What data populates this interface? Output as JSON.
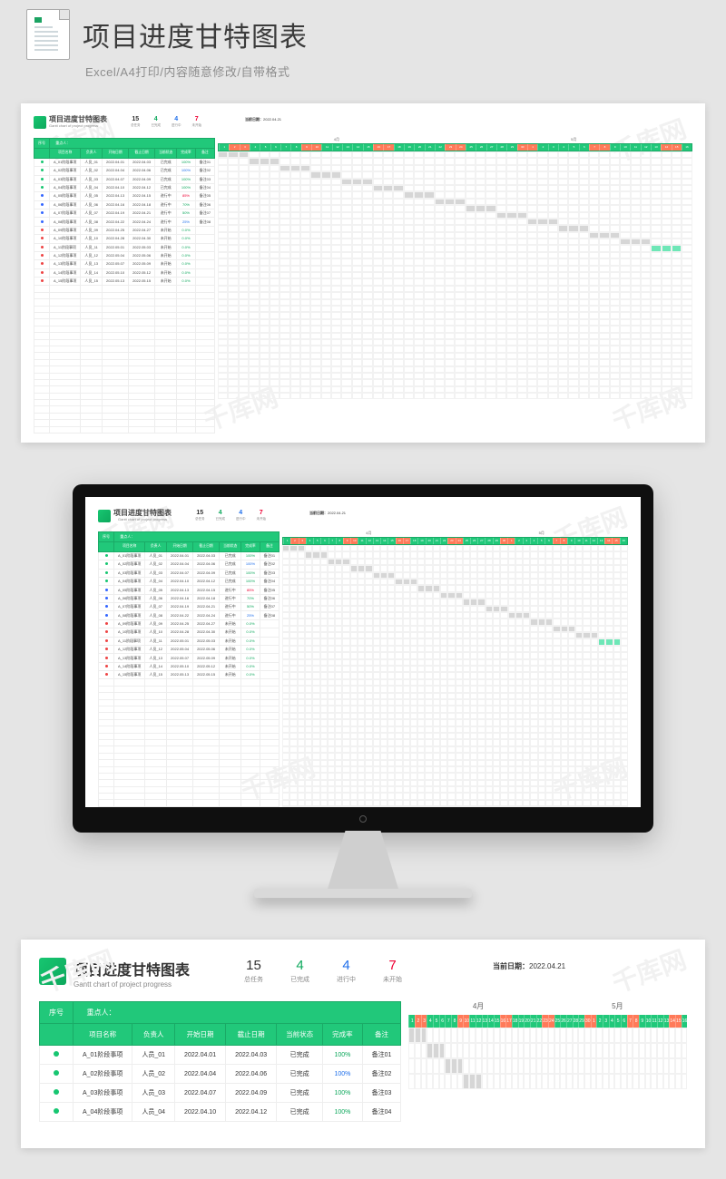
{
  "header": {
    "title": "项目进度甘特图表",
    "subtitle": "Excel/A4打印/内容随意修改/自带格式"
  },
  "watermark": "千库网",
  "template": {
    "title": "项目进度甘特图表",
    "title_en": "Gantt chart of project progress",
    "stats": [
      {
        "n": "15",
        "l": "总任务",
        "color": "#333"
      },
      {
        "n": "4",
        "l": "已完成",
        "color": "#0da85c"
      },
      {
        "n": "4",
        "l": "进行中",
        "color": "#1f6feb"
      },
      {
        "n": "7",
        "l": "未开始",
        "color": "#e03"
      }
    ],
    "date_label": "当前日期：",
    "date_value": "2022.04.21",
    "cols_top": [
      "序号",
      "",
      "",
      "",
      "",
      "",
      "",
      ""
    ],
    "cols": [
      "",
      "项目名称",
      "负责人",
      "开始日期",
      "截止日期",
      "当前状态",
      "完成率",
      "备注"
    ],
    "rows": [
      {
        "c": "g",
        "name": "A_01阶段事项",
        "owner": "人员_01",
        "start": "2022.04.01",
        "end": "2022.04.03",
        "status": "已完成",
        "pct": "100%",
        "pcls": "pct-green",
        "note": "备注01"
      },
      {
        "c": "g",
        "name": "A_02阶段事项",
        "owner": "人员_02",
        "start": "2022.04.04",
        "end": "2022.04.06",
        "status": "已完成",
        "pct": "100%",
        "pcls": "pct-blue",
        "note": "备注02"
      },
      {
        "c": "g",
        "name": "A_03阶段事项",
        "owner": "人员_03",
        "start": "2022.04.07",
        "end": "2022.04.09",
        "status": "已完成",
        "pct": "100%",
        "pcls": "pct-green",
        "note": "备注03"
      },
      {
        "c": "g",
        "name": "A_04阶段事项",
        "owner": "人员_04",
        "start": "2022.04.10",
        "end": "2022.04.12",
        "status": "已完成",
        "pct": "100%",
        "pcls": "pct-green",
        "note": "备注04"
      },
      {
        "c": "b",
        "name": "A_05阶段事项",
        "owner": "人员_05",
        "start": "2022.04.13",
        "end": "2022.04.15",
        "status": "进行中",
        "pct": "85%",
        "pcls": "pct-red",
        "note": "备注05"
      },
      {
        "c": "b",
        "name": "A_06阶段事项",
        "owner": "人员_06",
        "start": "2022.04.16",
        "end": "2022.04.18",
        "status": "进行中",
        "pct": "70%",
        "pcls": "pct-green",
        "note": "备注06"
      },
      {
        "c": "b",
        "name": "A_07阶段事项",
        "owner": "人员_07",
        "start": "2022.04.19",
        "end": "2022.04.21",
        "status": "进行中",
        "pct": "50%",
        "pcls": "pct-green",
        "note": "备注07"
      },
      {
        "c": "b",
        "name": "A_08阶段事项",
        "owner": "人员_08",
        "start": "2022.04.22",
        "end": "2022.04.24",
        "status": "进行中",
        "pct": "25%",
        "pcls": "pct-blue",
        "note": "备注08"
      },
      {
        "c": "r",
        "name": "A_09阶段事项",
        "owner": "人员_09",
        "start": "2022.04.25",
        "end": "2022.04.27",
        "status": "未开始",
        "pct": "0.0%",
        "pcls": "pct-green",
        "note": ""
      },
      {
        "c": "r",
        "name": "A_10阶段事项",
        "owner": "人员_10",
        "start": "2022.04.28",
        "end": "2022.04.30",
        "status": "未开始",
        "pct": "0.0%",
        "pcls": "pct-green",
        "note": ""
      },
      {
        "c": "r",
        "name": "A_11阶段事项",
        "owner": "人员_11",
        "start": "2022.05.01",
        "end": "2022.05.03",
        "status": "未开始",
        "pct": "0.0%",
        "pcls": "pct-green",
        "note": ""
      },
      {
        "c": "r",
        "name": "A_12阶段事项",
        "owner": "人员_12",
        "start": "2022.05.04",
        "end": "2022.05.06",
        "status": "未开始",
        "pct": "0.0%",
        "pcls": "pct-green",
        "note": ""
      },
      {
        "c": "r",
        "name": "A_13阶段事项",
        "owner": "人员_13",
        "start": "2022.05.07",
        "end": "2022.05.09",
        "status": "未开始",
        "pct": "0.0%",
        "pcls": "pct-green",
        "note": ""
      },
      {
        "c": "r",
        "name": "A_14阶段事项",
        "owner": "人员_14",
        "start": "2022.05.10",
        "end": "2022.05.12",
        "status": "未开始",
        "pct": "0.0%",
        "pcls": "pct-green",
        "note": ""
      },
      {
        "c": "r",
        "name": "A_15阶段事项",
        "owner": "人员_15",
        "start": "2022.05.13",
        "end": "2022.05.15",
        "status": "未开始",
        "pct": "0.0%",
        "pcls": "pct-green",
        "note": ""
      }
    ],
    "months": [
      "4月",
      "5月"
    ],
    "weekend": [
      2,
      3,
      9,
      10,
      16,
      17,
      23,
      24,
      30,
      31,
      37,
      38,
      44,
      45
    ]
  }
}
